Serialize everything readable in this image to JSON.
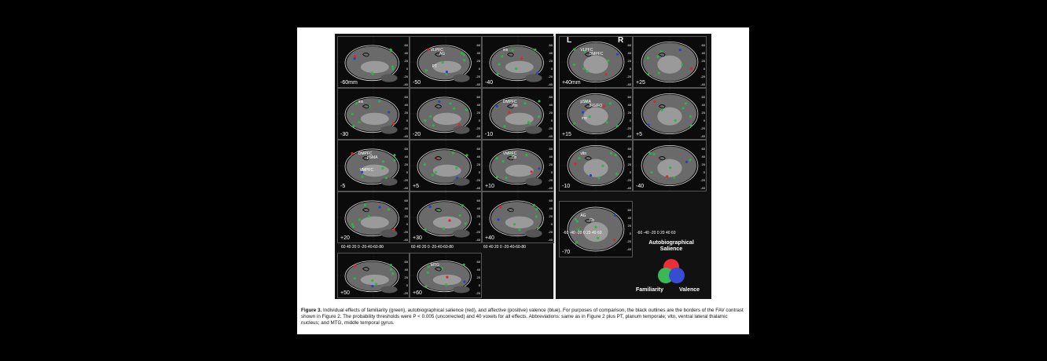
{
  "hemispheres": {
    "left": "L",
    "right": "R"
  },
  "sagittal_panels": [
    {
      "label": "-60mm",
      "rois": []
    },
    {
      "label": "-50",
      "rois": [
        "VLPFC",
        "AG",
        "PT"
      ]
    },
    {
      "label": "-40",
      "rois": [
        "ins"
      ]
    },
    {
      "label": "-30",
      "rois": [
        "ins"
      ]
    },
    {
      "label": "-20",
      "rois": []
    },
    {
      "label": "-10",
      "rois": [
        "DMPFC",
        "vltn"
      ]
    },
    {
      "label": "-5",
      "rois": [
        "DMPFC",
        "pSMA",
        "VMPFC"
      ]
    },
    {
      "label": "+5",
      "rois": []
    },
    {
      "label": "+10",
      "rois": [
        "VMPFC",
        "Cb"
      ]
    },
    {
      "label": "+20",
      "rois": []
    },
    {
      "label": "+30",
      "rois": []
    },
    {
      "label": "+40",
      "rois": []
    },
    {
      "label": "+50",
      "rois": []
    },
    {
      "label": "+60",
      "rois": [
        "MTG"
      ]
    }
  ],
  "coronal_panels": [
    {
      "label": "+40mm",
      "rois": [
        "VLPFC",
        "DMPFC"
      ]
    },
    {
      "label": "+25",
      "rois": []
    },
    {
      "label": "+15",
      "rois": [
        "pSMA",
        "IFG/FO",
        "ins"
      ]
    },
    {
      "label": "+5",
      "rois": []
    },
    {
      "label": "-10",
      "rois": [
        "vltn"
      ]
    },
    {
      "label": "-40",
      "rois": []
    },
    {
      "label": "-70",
      "rois": [
        "AG",
        "Cb"
      ]
    }
  ],
  "y_ticks": [
    "60",
    "40",
    "20",
    "0",
    "-20",
    "-40"
  ],
  "sagittal_x_axis": "60 40 20 0 -20-40-60-80",
  "coronal_x_axis": "-60 -40 -20 0 20 40 60",
  "legend": {
    "title": "Autobiographical Salience",
    "left": "Familiarity",
    "right": "Valence",
    "colors": {
      "familiarity": "#2db34a",
      "salience": "#e8202a",
      "valence": "#2a3fd0"
    }
  },
  "caption": {
    "label": "Figure 3.",
    "text": "Individual effects of familiarity (green), autobiographical salience (red), and affective (positive) valence (blue). For purposes of comparison, the black outlines are the borders of the FAV contrast shown in Figure 2. The probability thresholds were P < 0.005 (uncorrected) and 40 voxels for all effects. Abbreviations: same as in Figure 2 plus PT, planum temporale; vltn, ventral lateral thalamic nucleus; and MTG, middle temporal gyrus."
  }
}
